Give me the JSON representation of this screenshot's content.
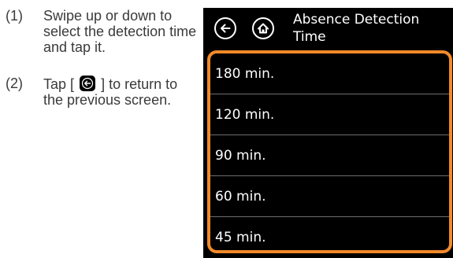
{
  "instructions": {
    "step1": {
      "number": "(1)",
      "text": "Swipe up or down to select the detection time and tap it."
    },
    "step2": {
      "number": "(2)",
      "text_before": "Tap [",
      "text_after": "] to return to the previous screen."
    }
  },
  "screen": {
    "title": "Absence Detection Time",
    "back_icon": "back-arrow-icon",
    "home_icon": "home-icon",
    "highlight_color": "#f28a2a",
    "options": [
      "180 min.",
      "120 min.",
      "90 min.",
      "60 min.",
      "45 min."
    ]
  }
}
